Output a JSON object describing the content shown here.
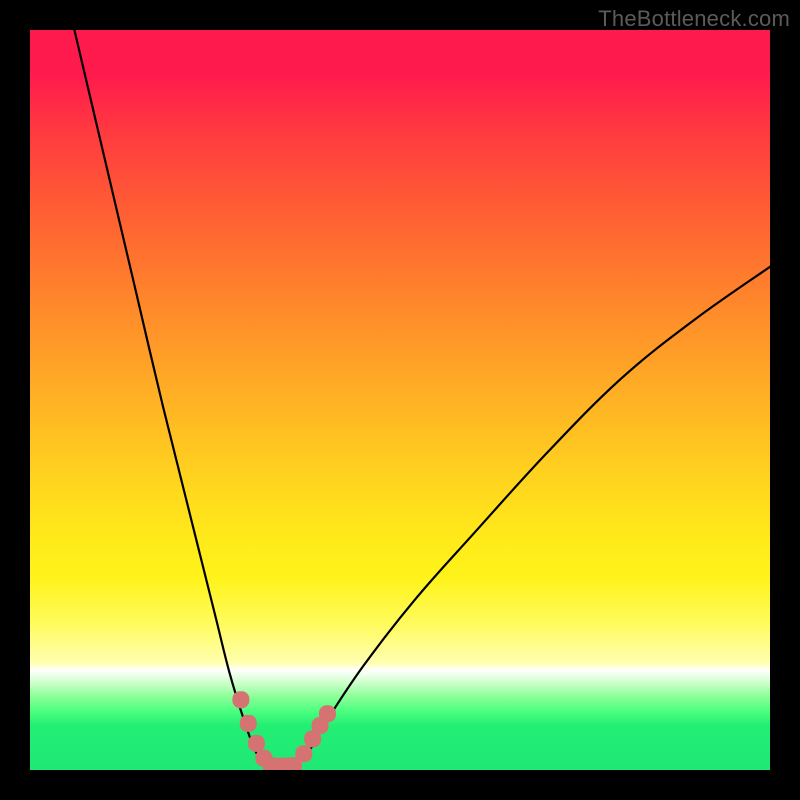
{
  "watermark": "TheBottleneck.com",
  "colors": {
    "frame": "#000000",
    "curve": "#000000",
    "marker": "#d57373",
    "gradient_top": "#ff1a4d",
    "gradient_bottom": "#1fe874"
  },
  "chart_data": {
    "type": "line",
    "title": "",
    "xlabel": "",
    "ylabel": "",
    "xlim": [
      0,
      100
    ],
    "ylim": [
      0,
      100
    ],
    "notes": "Bottleneck-style V curve. x roughly represents a component balance axis; y is bottleneck severity (0=none, 100=max). Minimum near x≈33 with a flat floor segment. Curve steeper on left side than right. Background is a vertical severity color gradient (red=high, green=low). Small salmon markers lie along the lower portion of the curve and across the floor.",
    "series": [
      {
        "name": "bottleneck-curve",
        "x": [
          6,
          10,
          14,
          18,
          22,
          25,
          27,
          29,
          30.5,
          32,
          34,
          36,
          38,
          40,
          45,
          52,
          60,
          70,
          80,
          90,
          100
        ],
        "values": [
          100,
          83,
          66,
          49,
          33,
          21,
          13,
          6.5,
          2.5,
          0.5,
          0.5,
          0.8,
          3,
          6.5,
          14,
          23,
          32,
          43,
          53,
          61,
          68
        ]
      }
    ],
    "markers": {
      "name": "highlight-points",
      "x": [
        28.5,
        29.5,
        30.6,
        31.6,
        32.6,
        33.6,
        34.6,
        35.6,
        37.0,
        38.2,
        39.2,
        40.2
      ],
      "values": [
        9.5,
        6.3,
        3.6,
        1.6,
        0.6,
        0.5,
        0.5,
        0.6,
        2.2,
        4.2,
        6.0,
        7.6
      ]
    }
  }
}
